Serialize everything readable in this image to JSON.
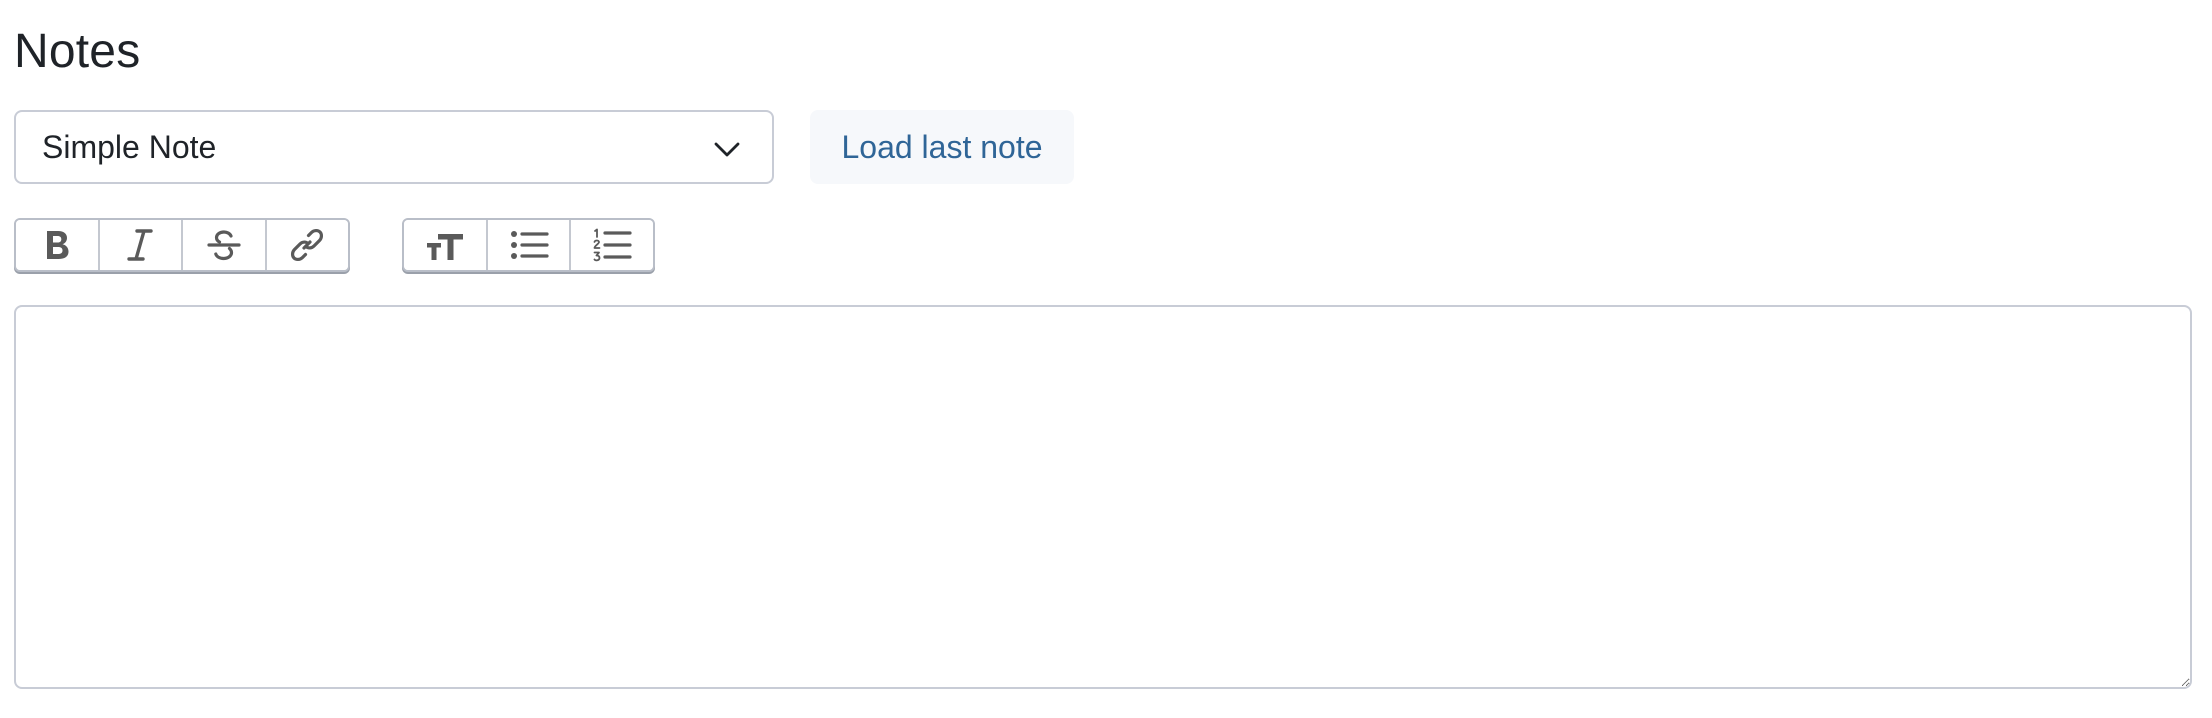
{
  "page": {
    "title": "Notes"
  },
  "note_type_select": {
    "selected": "Simple Note",
    "icon": "chevron-down-icon"
  },
  "load_button": {
    "label": "Load last note"
  },
  "toolbar": {
    "group1": [
      {
        "name": "bold",
        "icon": "bold-icon"
      },
      {
        "name": "italic",
        "icon": "italic-icon"
      },
      {
        "name": "strikethrough",
        "icon": "strikethrough-icon"
      },
      {
        "name": "link",
        "icon": "link-icon"
      }
    ],
    "group2": [
      {
        "name": "heading",
        "icon": "heading-icon"
      },
      {
        "name": "bullet-list",
        "icon": "bullet-list-icon"
      },
      {
        "name": "numbered-list",
        "icon": "numbered-list-icon"
      }
    ]
  },
  "editor": {
    "value": ""
  },
  "colors": {
    "text": "#1f2328",
    "link": "#2f6597",
    "border": "#c8ccd6",
    "icon": "#5a5a5a",
    "button_bg": "#f6f8fb"
  }
}
